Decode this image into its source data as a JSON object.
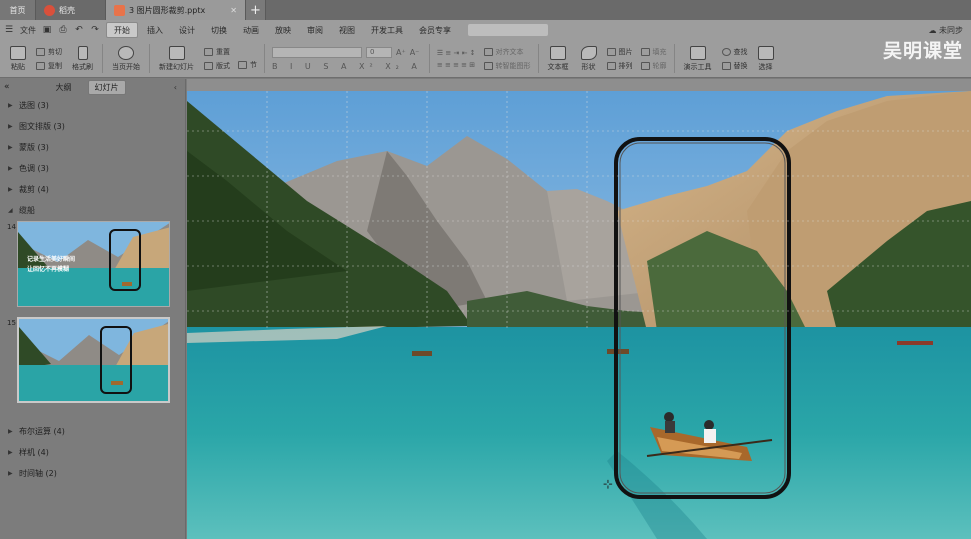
{
  "tabs": [
    {
      "label": "首页",
      "active": false
    },
    {
      "label": "稻壳",
      "active": false,
      "icon_color": "#d9503b"
    },
    {
      "label": "3 图片圆形裁剪.pptx",
      "active": true,
      "icon_color": "#e8734a"
    }
  ],
  "tab_add": "+",
  "menu": {
    "file": "文件",
    "quick_icons": [
      "save-icon",
      "print-icon",
      "undo-icon",
      "redo-icon"
    ],
    "items": [
      {
        "label": "开始",
        "active": true
      },
      {
        "label": "插入"
      },
      {
        "label": "设计"
      },
      {
        "label": "切换"
      },
      {
        "label": "动画"
      },
      {
        "label": "放映"
      },
      {
        "label": "审阅"
      },
      {
        "label": "视图"
      },
      {
        "label": "开发工具"
      },
      {
        "label": "会员专享"
      }
    ],
    "sync": "未同步"
  },
  "ribbon": {
    "paste": "粘贴",
    "cut": "剪切",
    "copy": "复制",
    "format_painter": "格式刷",
    "slideshow": "当页开始",
    "new_slide": "新建幻灯片",
    "layout": "版式",
    "section": "节",
    "reset": "重置",
    "font_size": "0",
    "format_letters": "B I U S A X² X₂ A",
    "text_box": "文本框",
    "shape": "形状",
    "arrange": "排列",
    "picture": "图片",
    "fill": "填充",
    "outline": "轮廓",
    "presentation_tools": "演示工具",
    "find": "查找",
    "replace": "替换",
    "select": "选择",
    "align_text": "对齐文本",
    "convert_smartart": "转智能图形"
  },
  "watermark": "吴明课堂",
  "sidebar": {
    "tabs": [
      {
        "label": "大纲"
      },
      {
        "label": "幻灯片",
        "active": true
      }
    ],
    "sections_top": [
      {
        "label": "选图 (3)"
      },
      {
        "label": "图文排版 (3)"
      },
      {
        "label": "蒙版 (3)"
      },
      {
        "label": "色调 (3)"
      },
      {
        "label": "裁剪 (4)"
      },
      {
        "label": "缆船",
        "expanded": true
      }
    ],
    "thumbs": [
      {
        "number": "14",
        "caption1": "记录生活美好瞬间",
        "caption2": "让回忆不再模糊"
      },
      {
        "number": "15",
        "selected": true
      }
    ],
    "sections_bottom": [
      {
        "label": "布尔运算 (4)"
      },
      {
        "label": "样机 (4)"
      },
      {
        "label": "时间轴 (2)"
      }
    ]
  },
  "colors": {
    "sky": "#6aa8d9",
    "water": "#2aa4a6",
    "forest": "#2f4a26",
    "mountain": "#8f8b86",
    "cliff": "#c7a77a"
  }
}
